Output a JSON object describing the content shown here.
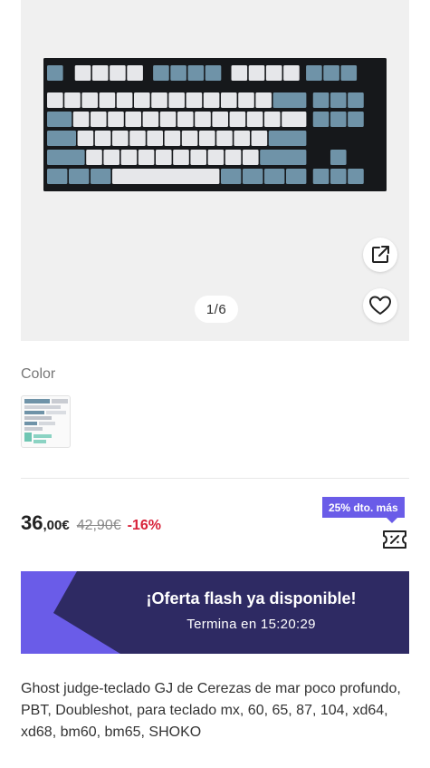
{
  "gallery": {
    "counter": "1/6",
    "share_icon": "external-link-icon",
    "favorite_icon": "heart-icon"
  },
  "color_section": {
    "label": "Color"
  },
  "price": {
    "integer": "36",
    "decimal": ",00€",
    "original": "42,90€",
    "discount": "-16%"
  },
  "coupon": {
    "badge": "25% dto. más",
    "icon": "coupon-icon"
  },
  "flash_sale": {
    "title": "¡Oferta flash ya disponible!",
    "countdown": "Termina en 15:20:29"
  },
  "product": {
    "title": "Ghost judge-teclado GJ de Cerezas de mar poco profundo, PBT, Doubleshot, para teclado mx, 60, 65, 87, 104, xd64, xd68, bm60, bm65, SHOKO"
  },
  "colors": {
    "accent": "#6a5ce8",
    "flash_bg": "#2e2a63",
    "discount": "#d8233a",
    "keycap_blue": "#6f93a8",
    "keycap_white": "#e6e7ea"
  }
}
